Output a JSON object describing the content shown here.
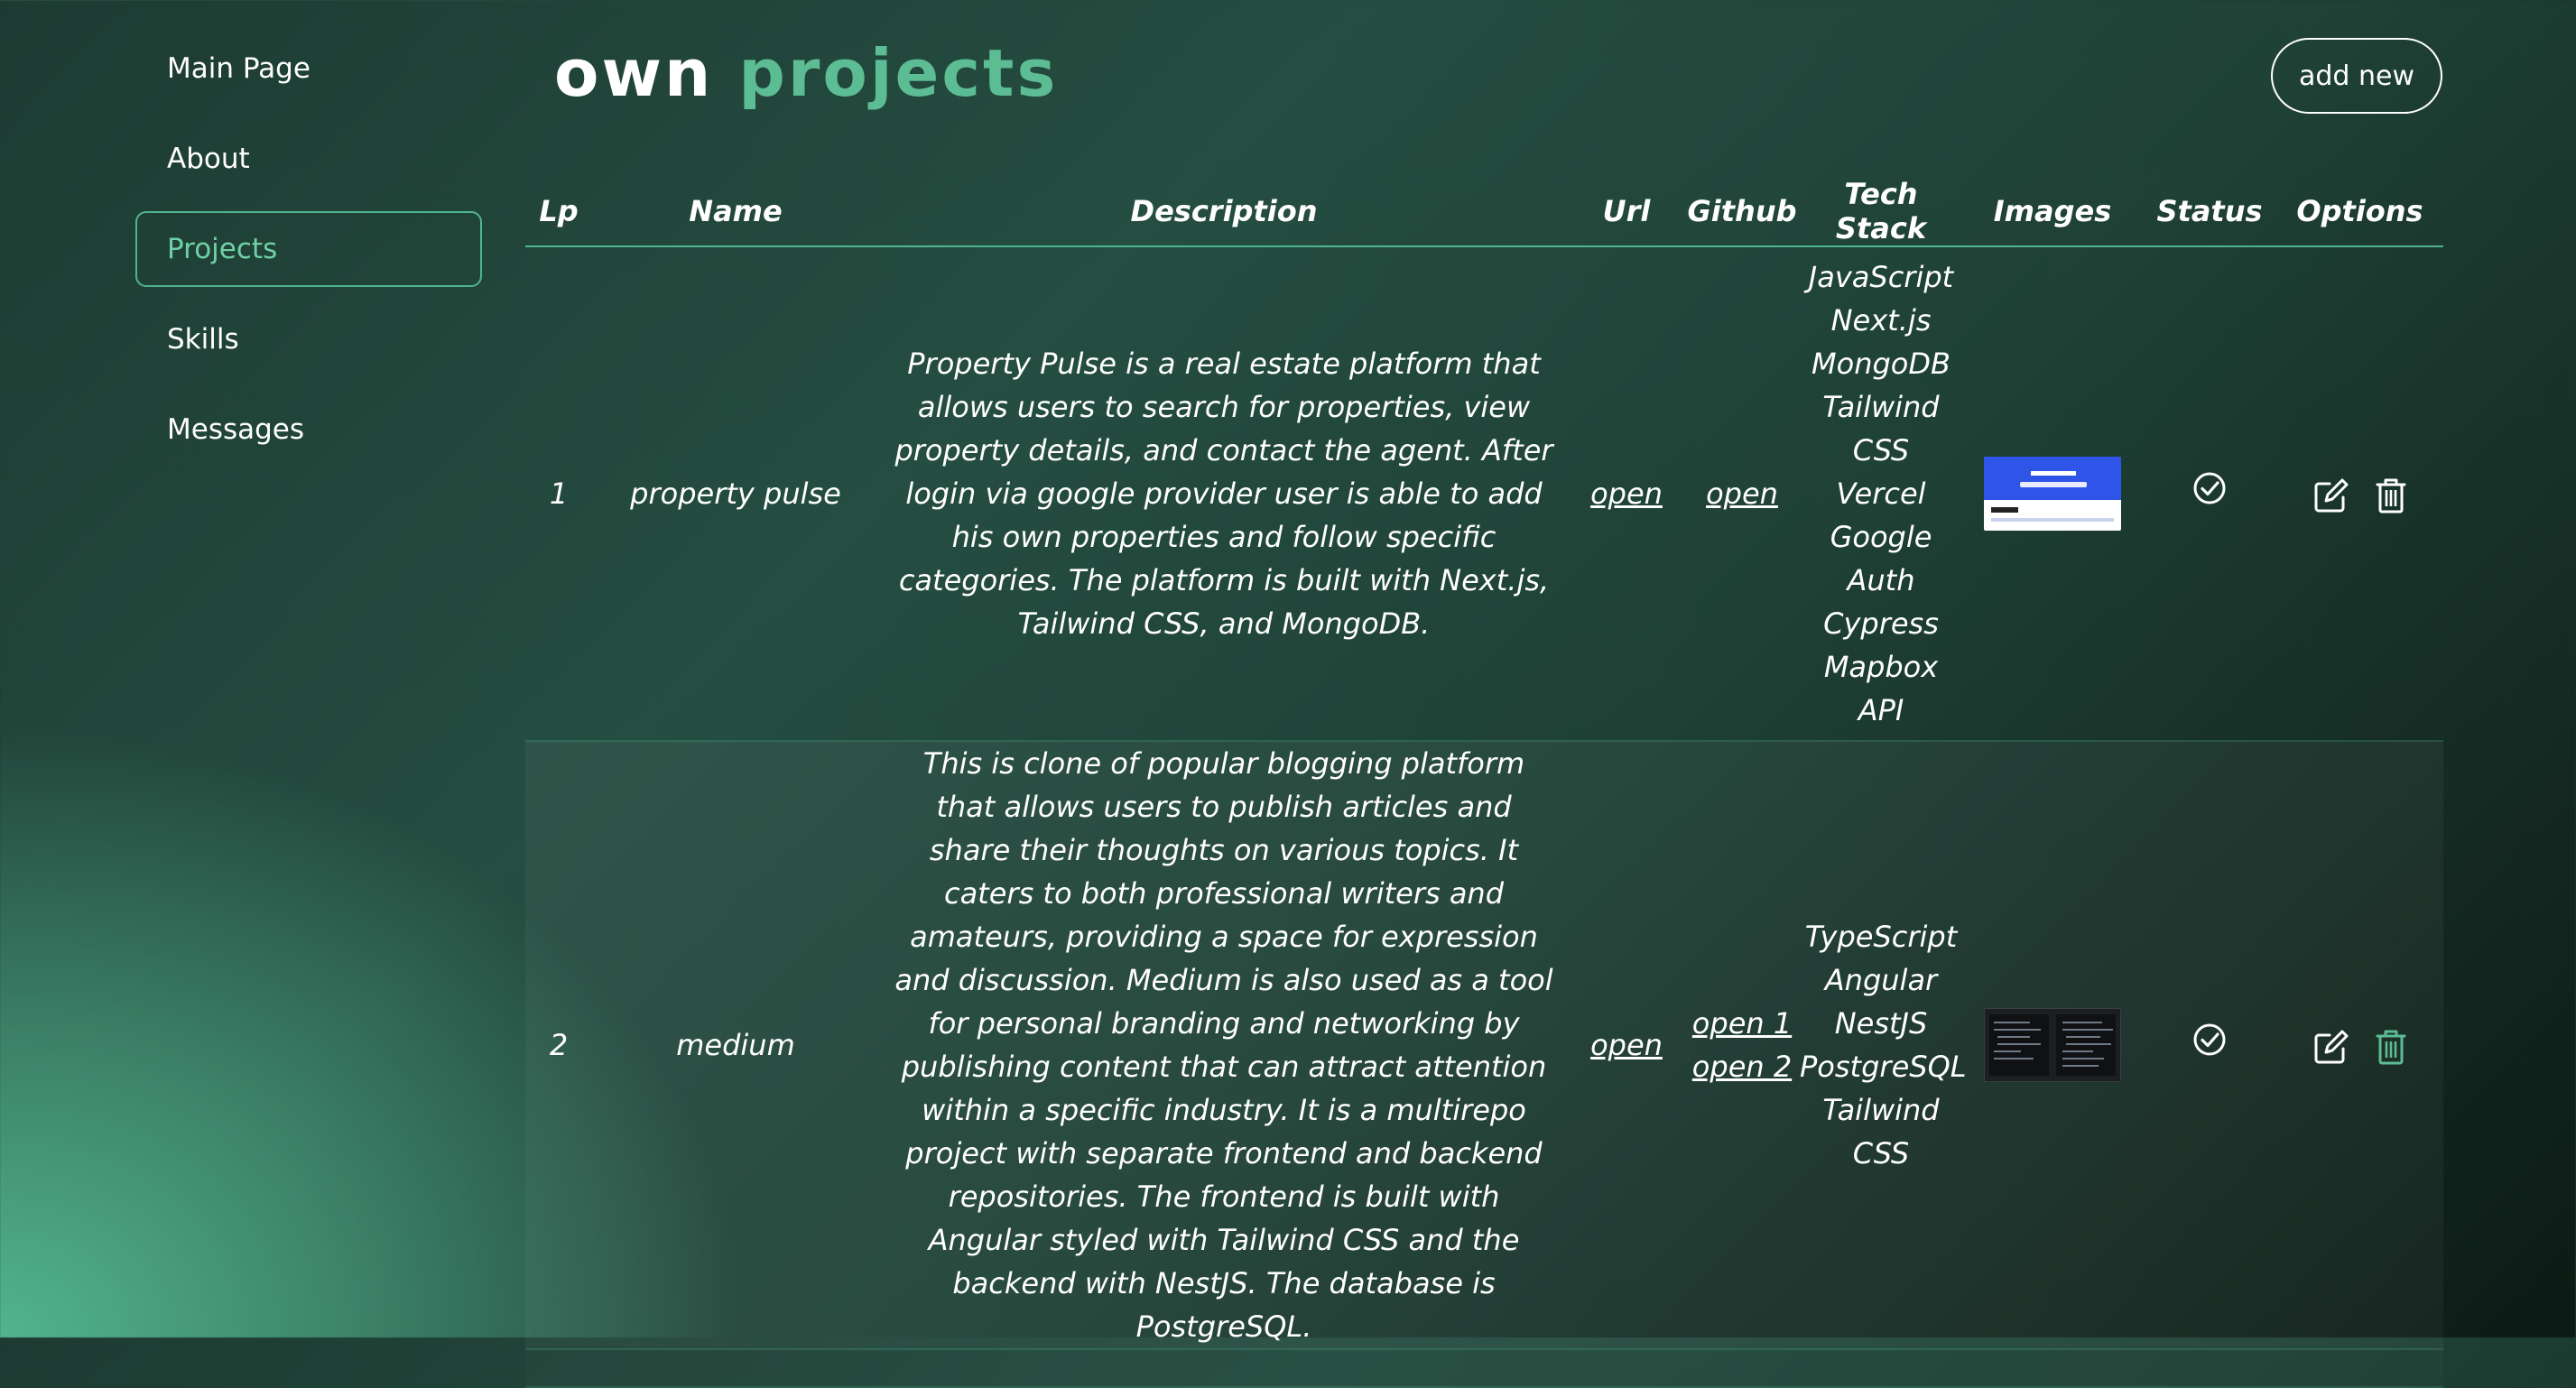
{
  "sidebar": {
    "items": [
      {
        "label": "Main Page",
        "active": false
      },
      {
        "label": "About",
        "active": false
      },
      {
        "label": "Projects",
        "active": true
      },
      {
        "label": "Skills",
        "active": false
      },
      {
        "label": "Messages",
        "active": false
      }
    ]
  },
  "header": {
    "title_part1": "own",
    "title_part2": "projects",
    "add_button_label": "add new"
  },
  "table": {
    "columns": [
      "Lp",
      "Name",
      "Description",
      "Url",
      "Github",
      "Tech Stack",
      "Images",
      "Status",
      "Options"
    ],
    "rows": [
      {
        "lp": "1",
        "name": "property pulse",
        "description": "Property Pulse is a real estate platform that allows users to search for properties, view property details, and contact the agent. After login via google provider user is able to add his own properties and follow specific categories. The platform is built with Next.js, Tailwind CSS, and MongoDB.",
        "url_label": "open",
        "github_links": [
          "open"
        ],
        "tech_stack": [
          "JavaScript",
          "Next.js",
          "MongoDB",
          "Tailwind",
          "CSS",
          "Vercel",
          "Google",
          "Auth",
          "Cypress",
          "Mapbox",
          "API"
        ],
        "image": "website-screenshot-thumbnail",
        "status_icon": "check-circle-icon",
        "edit_icon": "edit-icon",
        "delete_icon": "trash-icon",
        "delete_icon_color": "#ffffff"
      },
      {
        "lp": "2",
        "name": "medium",
        "description": "This is clone of popular blogging platform that allows users to publish articles and share their thoughts on various topics. It caters to both professional writers and amateurs, providing a space for expression and discussion. Medium is also used as a tool for personal branding and networking by publishing content that can attract attention within a specific industry. It is a multirepo project with separate frontend and backend repositories. The frontend is built with Angular styled with Tailwind CSS and the backend with NestJS. The database is PostgreSQL.",
        "url_label": "open",
        "github_links": [
          "open 1",
          "open 2"
        ],
        "tech_stack": [
          "TypeScript",
          "Angular",
          "NestJS",
          "PostgreSQL",
          "Tailwind",
          "CSS"
        ],
        "image": "code-editor-screenshot-thumbnail",
        "status_icon": "check-circle-icon",
        "edit_icon": "edit-icon",
        "delete_icon": "trash-icon",
        "delete_icon_color": "#5cbc93"
      }
    ]
  },
  "colors": {
    "accent": "#5cbc93",
    "border": "#4fb58e"
  }
}
